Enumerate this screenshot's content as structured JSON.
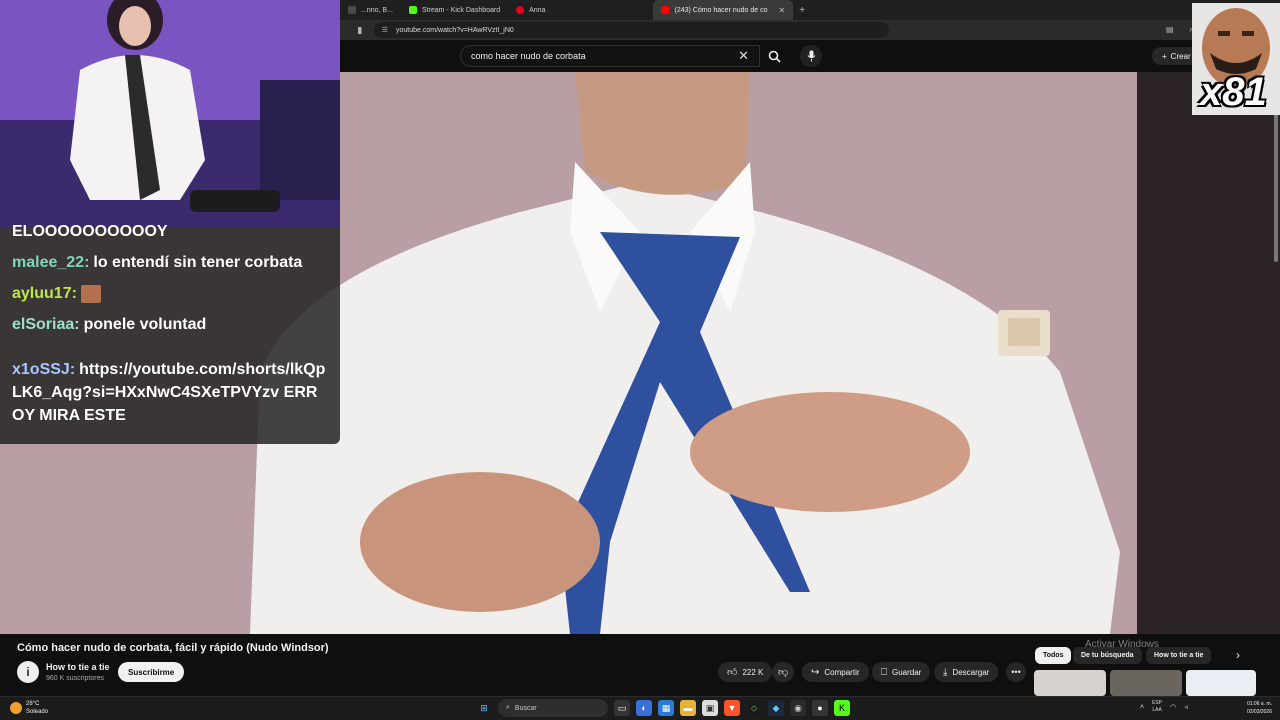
{
  "browser": {
    "tabs": [
      {
        "label": "...nno, B...",
        "favicon_color": "#4a4a4a"
      },
      {
        "label": "Stream - Kick Dashboard",
        "favicon_color": "#53fc18"
      },
      {
        "label": "Anna",
        "favicon_color": "#e60023"
      },
      {
        "label": "(243) Cómo hacer nudo de co",
        "favicon_color": "#ff0000",
        "active": true
      }
    ],
    "new_tab_icon": "plus-icon",
    "url": "youtube.com/watch?v=HAwRVztI_jN0"
  },
  "youtube": {
    "search_query": "como hacer nudo de corbata",
    "create_label": "Crear"
  },
  "overlay": {
    "chat": [
      {
        "user": "",
        "text": "ELOOOOOOOOOOY",
        "user_color": "#ffffff"
      },
      {
        "user": "malee_22:",
        "text": "lo entendí sin tener corbata",
        "user_color": "#7fd6b8"
      },
      {
        "user": "ayluu17:",
        "text": "",
        "user_color": "#bde84c",
        "emote": true
      },
      {
        "user": "elSoriaa:",
        "text": "ponele voluntad",
        "user_color": "#9be0c8"
      },
      {
        "user": "x1oSSJ:",
        "text": "https://youtube.com/shorts/lkQpLK6_Aqg?si=HXxNwC4SXeTPVYzv ERROY MIRA ESTE",
        "user_color": "#a8c8ff"
      }
    ],
    "reaction_count": "x81"
  },
  "video": {
    "title": "Cómo hacer nudo de corbata, fácil y rápido (Nudo Windsor)",
    "channel_name": "How to tie a tie",
    "channel_avatar_letter": "i",
    "subscribers": "960 K suscriptores",
    "subscribe_label": "Suscribirme",
    "likes": "222 K",
    "share_label": "Compartir",
    "save_label": "Guardar",
    "download_label": "Descargar"
  },
  "chips": {
    "all": "Todos",
    "from_search": "De tu búsqueda",
    "how_to": "How to tie a tie"
  },
  "watermark": {
    "title": "Activar Windows"
  },
  "taskbar": {
    "weather_temp": "28°C",
    "weather_desc": "Soleado",
    "search_label": "Buscar",
    "lang_top": "ESP",
    "lang_bottom": "LAA",
    "time": "01:06 a. m.",
    "date": "02/03/2026"
  }
}
